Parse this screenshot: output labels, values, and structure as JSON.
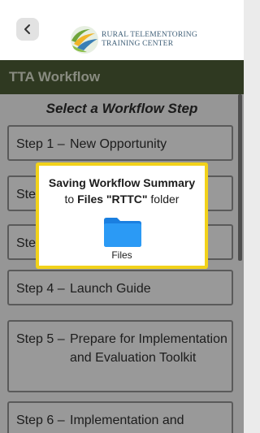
{
  "header": {
    "logo_line1": "Rural Telementoring",
    "logo_line2": "Training Center"
  },
  "titlebar": {
    "title": "TTA Workflow"
  },
  "main": {
    "subtitle": "Select a Workflow Step",
    "steps": [
      {
        "num": "Step 1 –",
        "label": "New Opportunity"
      },
      {
        "num": "Ste",
        "label": ""
      },
      {
        "num": "Ste",
        "label": ""
      },
      {
        "num": "Step 4 –",
        "label": "Launch Guide"
      },
      {
        "num": "Step 5 –",
        "label": "Prepare for Implementation and Evaluation Toolkit"
      },
      {
        "num": "Step 6 –",
        "label": "Implementation and"
      }
    ]
  },
  "modal": {
    "title": "Saving Workflow Summary",
    "to": "to",
    "files_label": "Files",
    "folder_name": "\"RTTC\"",
    "suffix": "folder",
    "icon_caption": "Files",
    "border_color": "#f2d21a",
    "folder_color": "#1a8cf0"
  },
  "colors": {
    "titlebar": "#4a5a34",
    "accent": "#f2d21a"
  },
  "icons": {
    "back": "chevron-left-icon",
    "folder": "folder-icon",
    "logo": "rttc-logo"
  }
}
